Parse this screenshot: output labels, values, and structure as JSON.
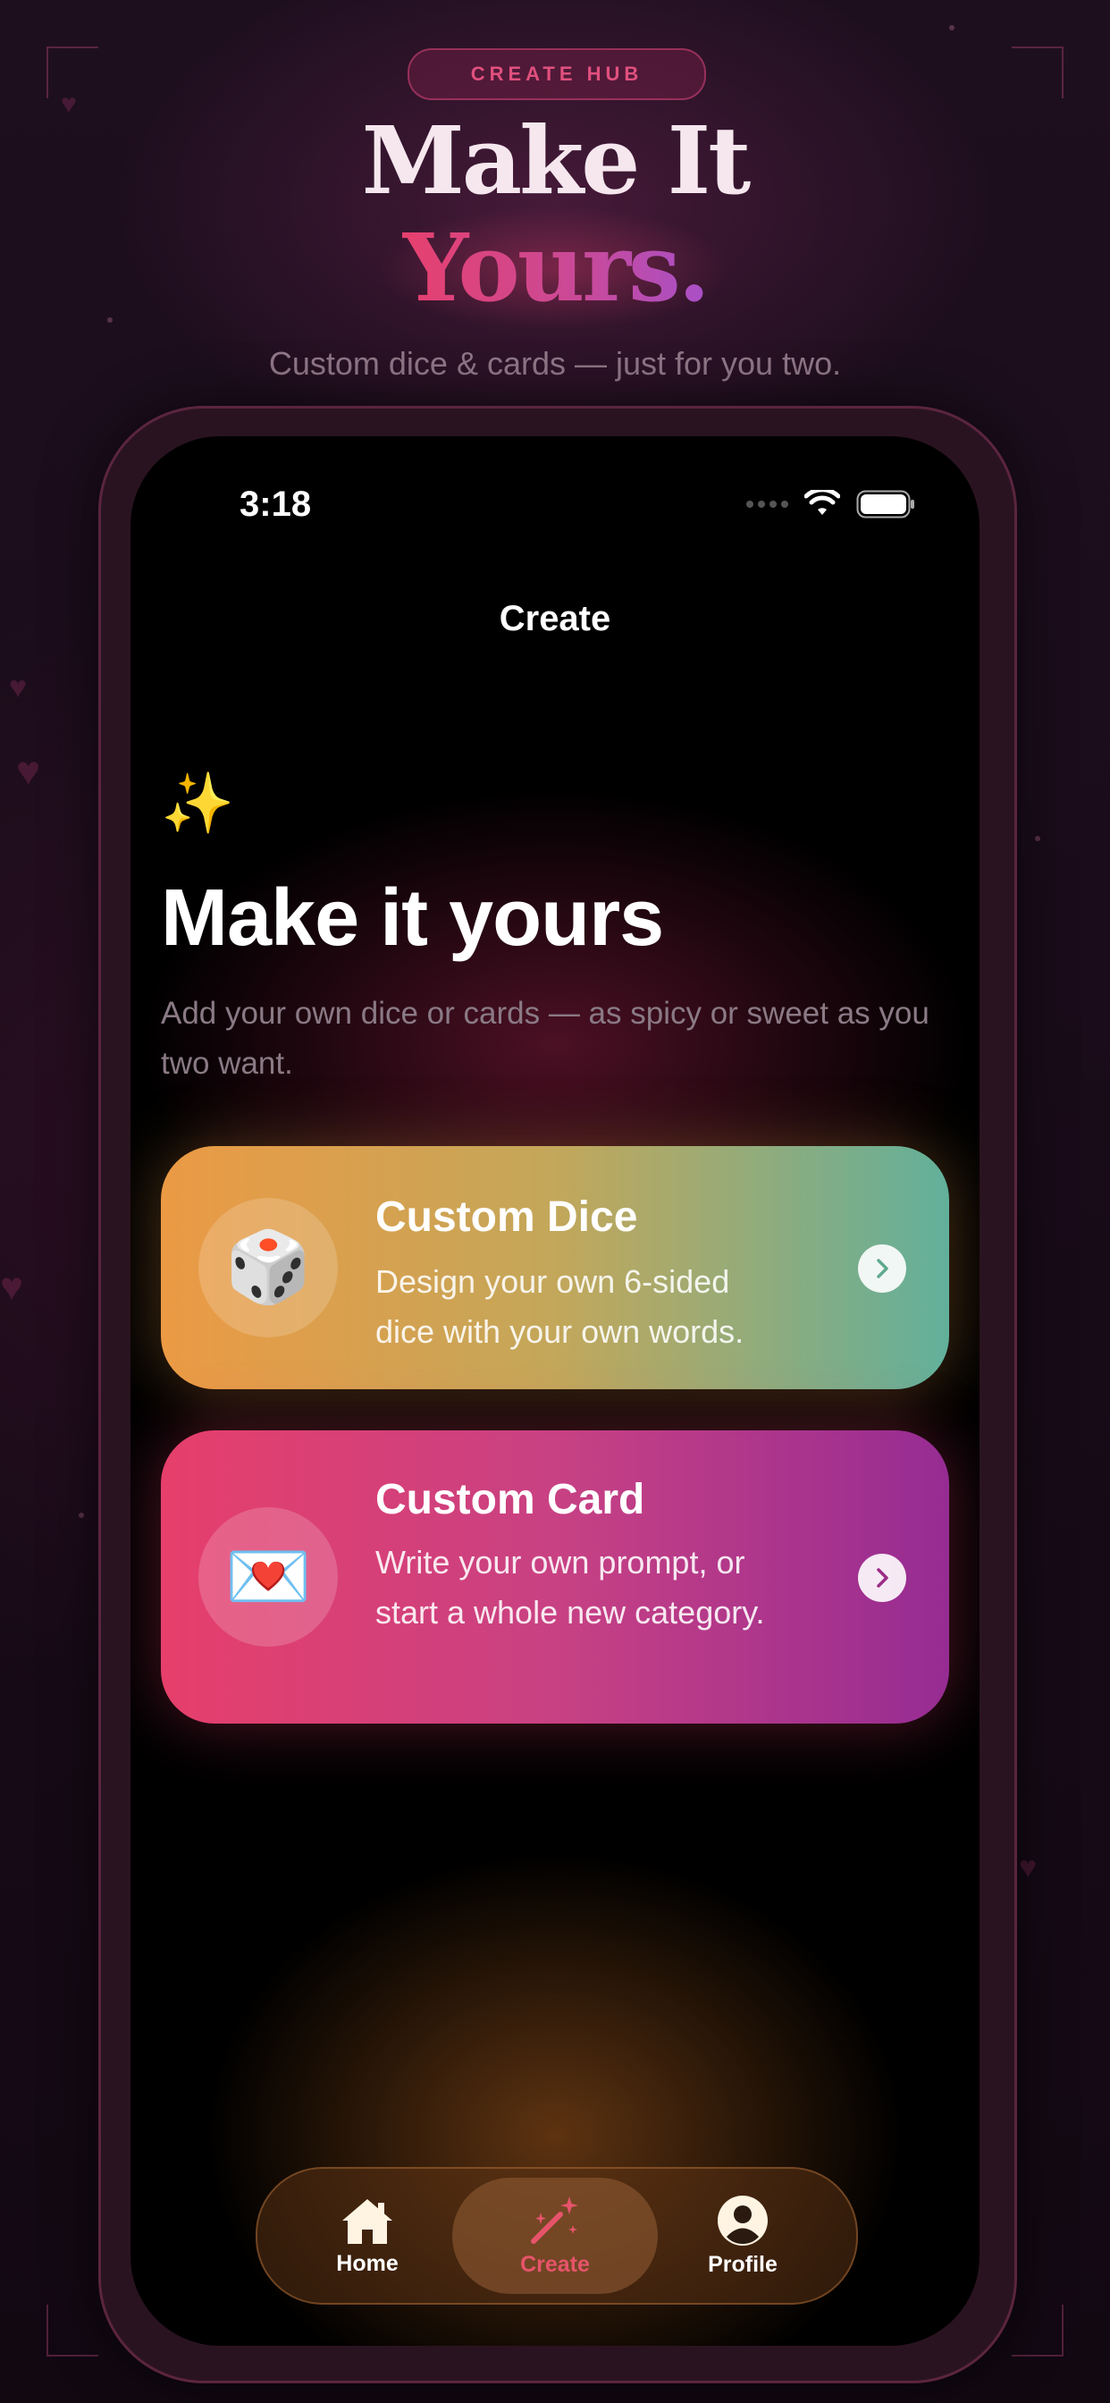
{
  "promo": {
    "badge": "CREATE HUB",
    "title_line1": "Make It",
    "title_line2": "Yours.",
    "subtitle": "Custom dice & cards — just for you two."
  },
  "status_bar": {
    "time": "3:18",
    "icons": [
      "cellular-dots-icon",
      "wifi-icon",
      "battery-icon"
    ]
  },
  "nav": {
    "title": "Create"
  },
  "hero": {
    "emoji": "✨",
    "title": "Make it yours",
    "subtitle": "Add your own dice or cards — as spicy or sweet as you two want."
  },
  "cards": [
    {
      "emoji": "🎲",
      "title": "Custom Dice",
      "description": "Design your own 6-sided dice with your own words.",
      "chevron_color": "#5fa98e"
    },
    {
      "emoji": "💌",
      "title": "Custom Card",
      "description": "Write your own prompt, or start a whole new category.",
      "chevron_color": "#9b2c86"
    }
  ],
  "tabbar": {
    "tabs": [
      {
        "label": "Home",
        "icon": "home-icon",
        "selected": false
      },
      {
        "label": "Create",
        "icon": "magic-wand-icon",
        "selected": true
      },
      {
        "label": "Profile",
        "icon": "person-circle-icon",
        "selected": false
      }
    ],
    "accent_color": "#e6546a"
  },
  "colors": {
    "background": "#1a0c1a",
    "accent_pink": "#e6406e",
    "accent_purple": "#a850c8",
    "dice_card_gradient": [
      "#ec9a44",
      "#62b09b"
    ],
    "custom_card_gradient": [
      "#e63f6b",
      "#962c93"
    ]
  }
}
